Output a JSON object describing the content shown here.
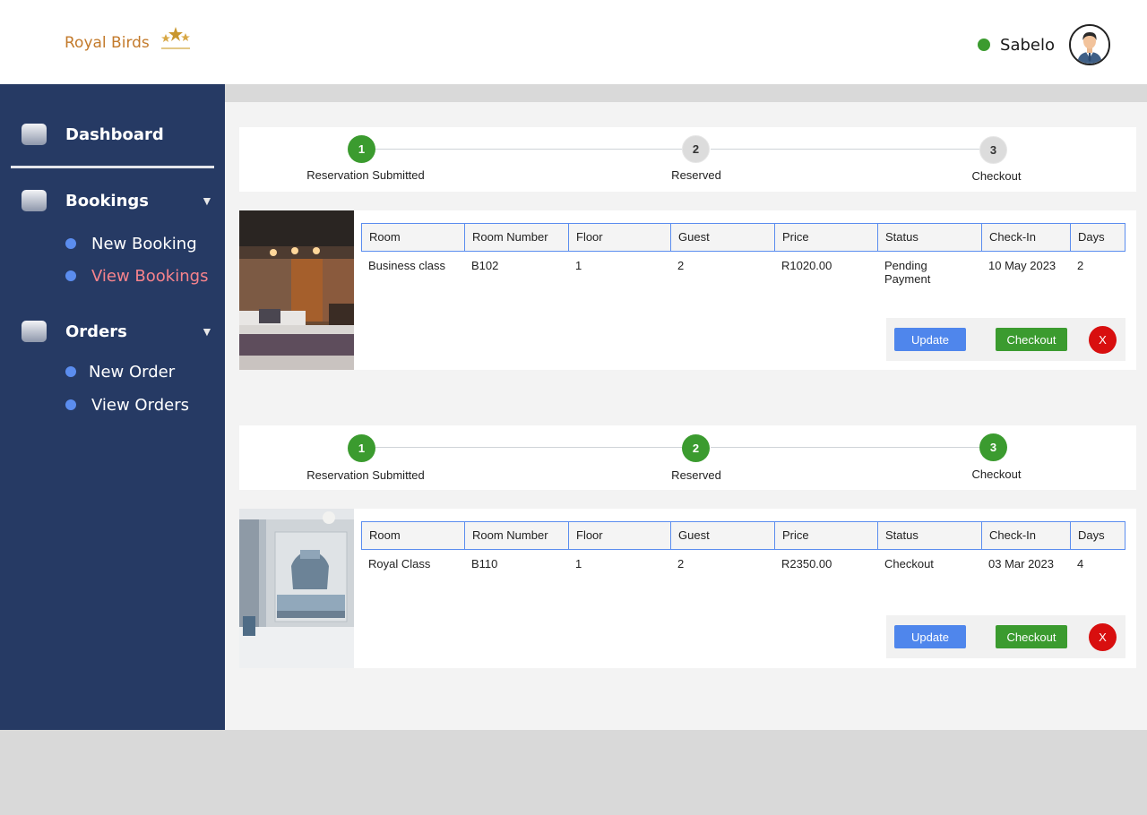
{
  "header": {
    "brand": "Royal Birds",
    "logo_icon": "stars-logo-icon",
    "user_name": "Sabelo",
    "status_color": "#3b9b2f"
  },
  "sidebar": {
    "dashboard": "Dashboard",
    "bookings": {
      "label": "Bookings",
      "items": [
        {
          "label": "New Booking"
        },
        {
          "label": "View Bookings",
          "active": true
        }
      ]
    },
    "orders": {
      "label": "Orders",
      "items": [
        {
          "label": "New Order"
        },
        {
          "label": "View Orders"
        }
      ]
    }
  },
  "table_headers": [
    "Room",
    "Room Number",
    "Floor",
    "Guest",
    "Price",
    "Status",
    "Check-In",
    "Days"
  ],
  "bookings": [
    {
      "steps": [
        {
          "number": "1",
          "label": "Reservation Submitted",
          "done": true
        },
        {
          "number": "2",
          "label": "Reserved",
          "done": false
        },
        {
          "number": "3",
          "label": "Checkout",
          "done": false
        }
      ],
      "row": {
        "room": "Business class",
        "room_number": "B102",
        "floor": "1",
        "guest": "2",
        "price": "R1020.00",
        "status_line1": "Pending",
        "status_line2": "Payment",
        "check_in": "10 May 2023",
        "days": "2"
      },
      "actions": {
        "update": "Update",
        "checkout": "Checkout",
        "remove": "X"
      }
    },
    {
      "steps": [
        {
          "number": "1",
          "label": "Reservation Submitted",
          "done": true
        },
        {
          "number": "2",
          "label": "Reserved",
          "done": true
        },
        {
          "number": "3",
          "label": "Checkout",
          "done": true
        }
      ],
      "row": {
        "room": "Royal Class",
        "room_number": "B110",
        "floor": "1",
        "guest": "2",
        "price": "R2350.00",
        "status_line1": "Checkout",
        "status_line2": "",
        "check_in": "03 Mar 2023",
        "days": "4"
      },
      "actions": {
        "update": "Update",
        "checkout": "Checkout",
        "remove": "X"
      }
    }
  ]
}
